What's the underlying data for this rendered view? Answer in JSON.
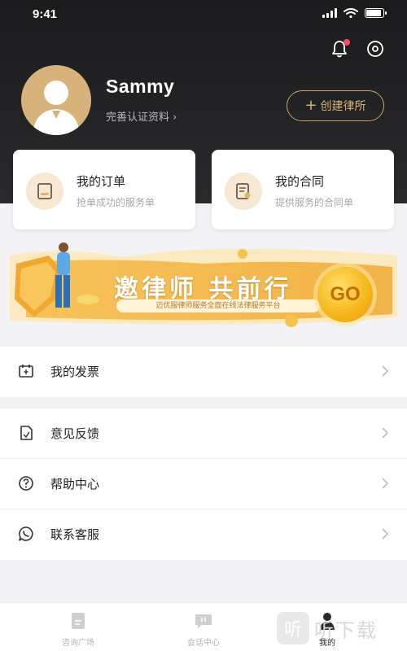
{
  "status_bar": {
    "time": "9:41",
    "battery_level": 0.9
  },
  "header": {
    "username": "Sammy",
    "complete_profile_link": "完善认证资料 ›",
    "create_button_label": "创建律所",
    "icons": {
      "notification": "bell-icon",
      "settings": "eye-icon"
    }
  },
  "cards": [
    {
      "title": "我的订单",
      "subtitle": "抢单成功的服务单",
      "icon": "order-icon"
    },
    {
      "title": "我的合同",
      "subtitle": "提供服务的合同单",
      "icon": "contract-icon"
    }
  ],
  "banner": {
    "title": "邀律师 共前行",
    "subtitle": "迈优服律师服务全面在线法律服务平台",
    "go_label": "GO"
  },
  "menu_group_1": [
    {
      "label": "我的发票",
      "icon": "invoice-icon"
    }
  ],
  "menu_group_2": [
    {
      "label": "意见反馈",
      "icon": "feedback-icon"
    },
    {
      "label": "帮助中心",
      "icon": "help-icon"
    },
    {
      "label": "联系客服",
      "icon": "customer-service-icon"
    }
  ],
  "tabbar": [
    {
      "label": "咨询广场",
      "icon": "square-icon",
      "active": false
    },
    {
      "label": "会话中心",
      "icon": "chat-icon",
      "active": false
    },
    {
      "label": "我的",
      "icon": "user-icon",
      "active": true
    }
  ],
  "watermark": {
    "badge": "听",
    "text": "听下载"
  },
  "colors": {
    "accent_gold": "#c9a36b",
    "header_dark": "#1b1b1d",
    "notification_dot": "#ff4a5c"
  }
}
